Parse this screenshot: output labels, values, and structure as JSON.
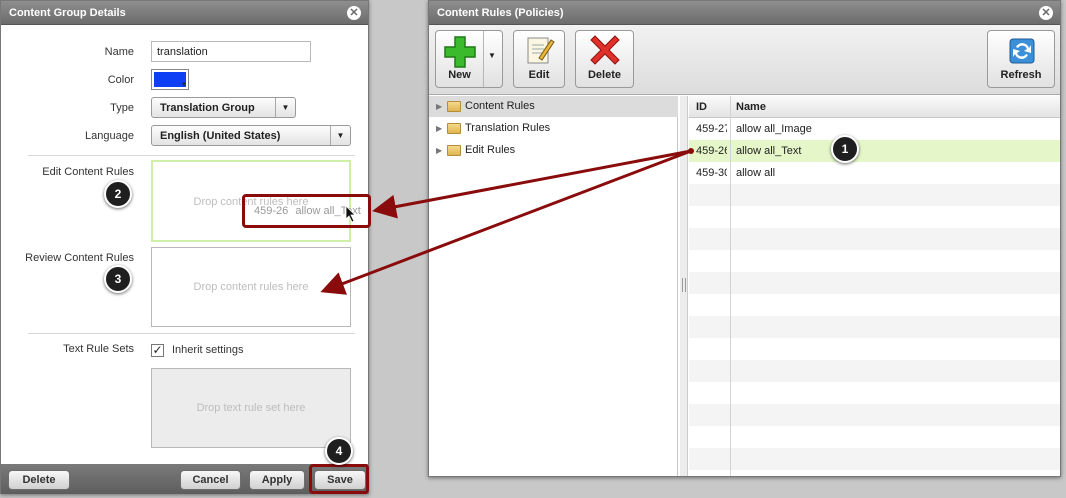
{
  "left_window": {
    "title": "Content Group Details",
    "name_label": "Name",
    "name_value": "translation",
    "color_label": "Color",
    "color_value": "#0f3ff5",
    "type_label": "Type",
    "type_value": "Translation Group",
    "language_label": "Language",
    "language_value": "English (United States)",
    "edit_rules_label": "Edit Content Rules",
    "review_rules_label": "Review Content Rules",
    "text_rule_sets_label": "Text Rule Sets",
    "drop_rules_placeholder": "Drop content rules here",
    "drop_rule_set_placeholder": "Drop text rule set here",
    "inherit_label": "Inherit settings",
    "inherit_checked": true,
    "drag_ghost_id": "459-26",
    "drag_ghost_name": "allow all_Text",
    "buttons": {
      "delete": "Delete",
      "cancel": "Cancel",
      "apply": "Apply",
      "save": "Save"
    }
  },
  "right_window": {
    "title": "Content Rules (Policies)",
    "toolbar": {
      "new": "New",
      "edit": "Edit",
      "delete": "Delete",
      "refresh": "Refresh"
    },
    "tree": [
      {
        "label": "Content Rules",
        "selected": true
      },
      {
        "label": "Translation Rules",
        "selected": false
      },
      {
        "label": "Edit Rules",
        "selected": false
      }
    ],
    "grid": {
      "columns": [
        "ID",
        "Name"
      ],
      "rows": [
        {
          "id": "459-27",
          "name": "allow all_Image"
        },
        {
          "id": "459-26",
          "name": "allow all_Text"
        },
        {
          "id": "459-30",
          "name": "allow all"
        }
      ]
    }
  },
  "annotations": [
    "1",
    "2",
    "3",
    "4"
  ],
  "colors": {
    "highlight": "#8a0b0b",
    "selected_row": "#e5f7c9",
    "titlebar": "#7d7d7d"
  }
}
